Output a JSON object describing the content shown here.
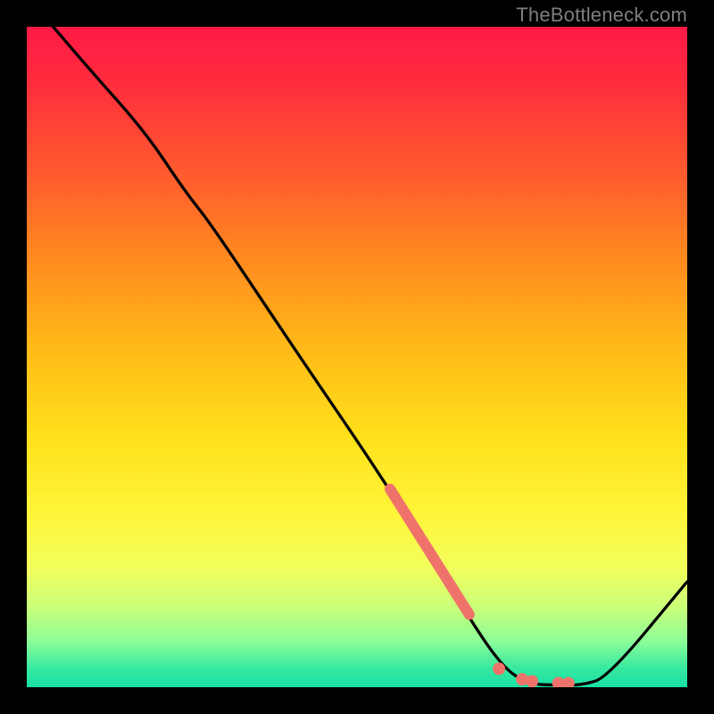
{
  "watermark": "TheBottleneck.com",
  "chart_data": {
    "type": "line",
    "title": "",
    "xlabel": "",
    "ylabel": "",
    "xlim": [
      0,
      100
    ],
    "ylim": [
      0,
      100
    ],
    "grid": false,
    "legend": false,
    "series": [
      {
        "name": "bottleneck-curve",
        "x": [
          4,
          10,
          18,
          24,
          28,
          40,
          55,
          66,
          72,
          76,
          80,
          84,
          88,
          100
        ],
        "y": [
          100,
          93,
          84,
          75,
          70,
          52,
          30,
          12,
          3,
          0.5,
          0.3,
          0.3,
          1.5,
          16
        ],
        "color": "#000000",
        "linewidth": 2
      }
    ],
    "highlight": {
      "name": "replacement-region",
      "color": "#ef736b",
      "segment": {
        "x": [
          55,
          67
        ],
        "y": [
          30,
          11
        ]
      },
      "dots": [
        {
          "x": 71.5,
          "y": 2.8
        },
        {
          "x": 75.0,
          "y": 1.2
        },
        {
          "x": 76.5,
          "y": 0.9
        },
        {
          "x": 80.5,
          "y": 0.6
        },
        {
          "x": 82.0,
          "y": 0.6
        }
      ]
    }
  }
}
